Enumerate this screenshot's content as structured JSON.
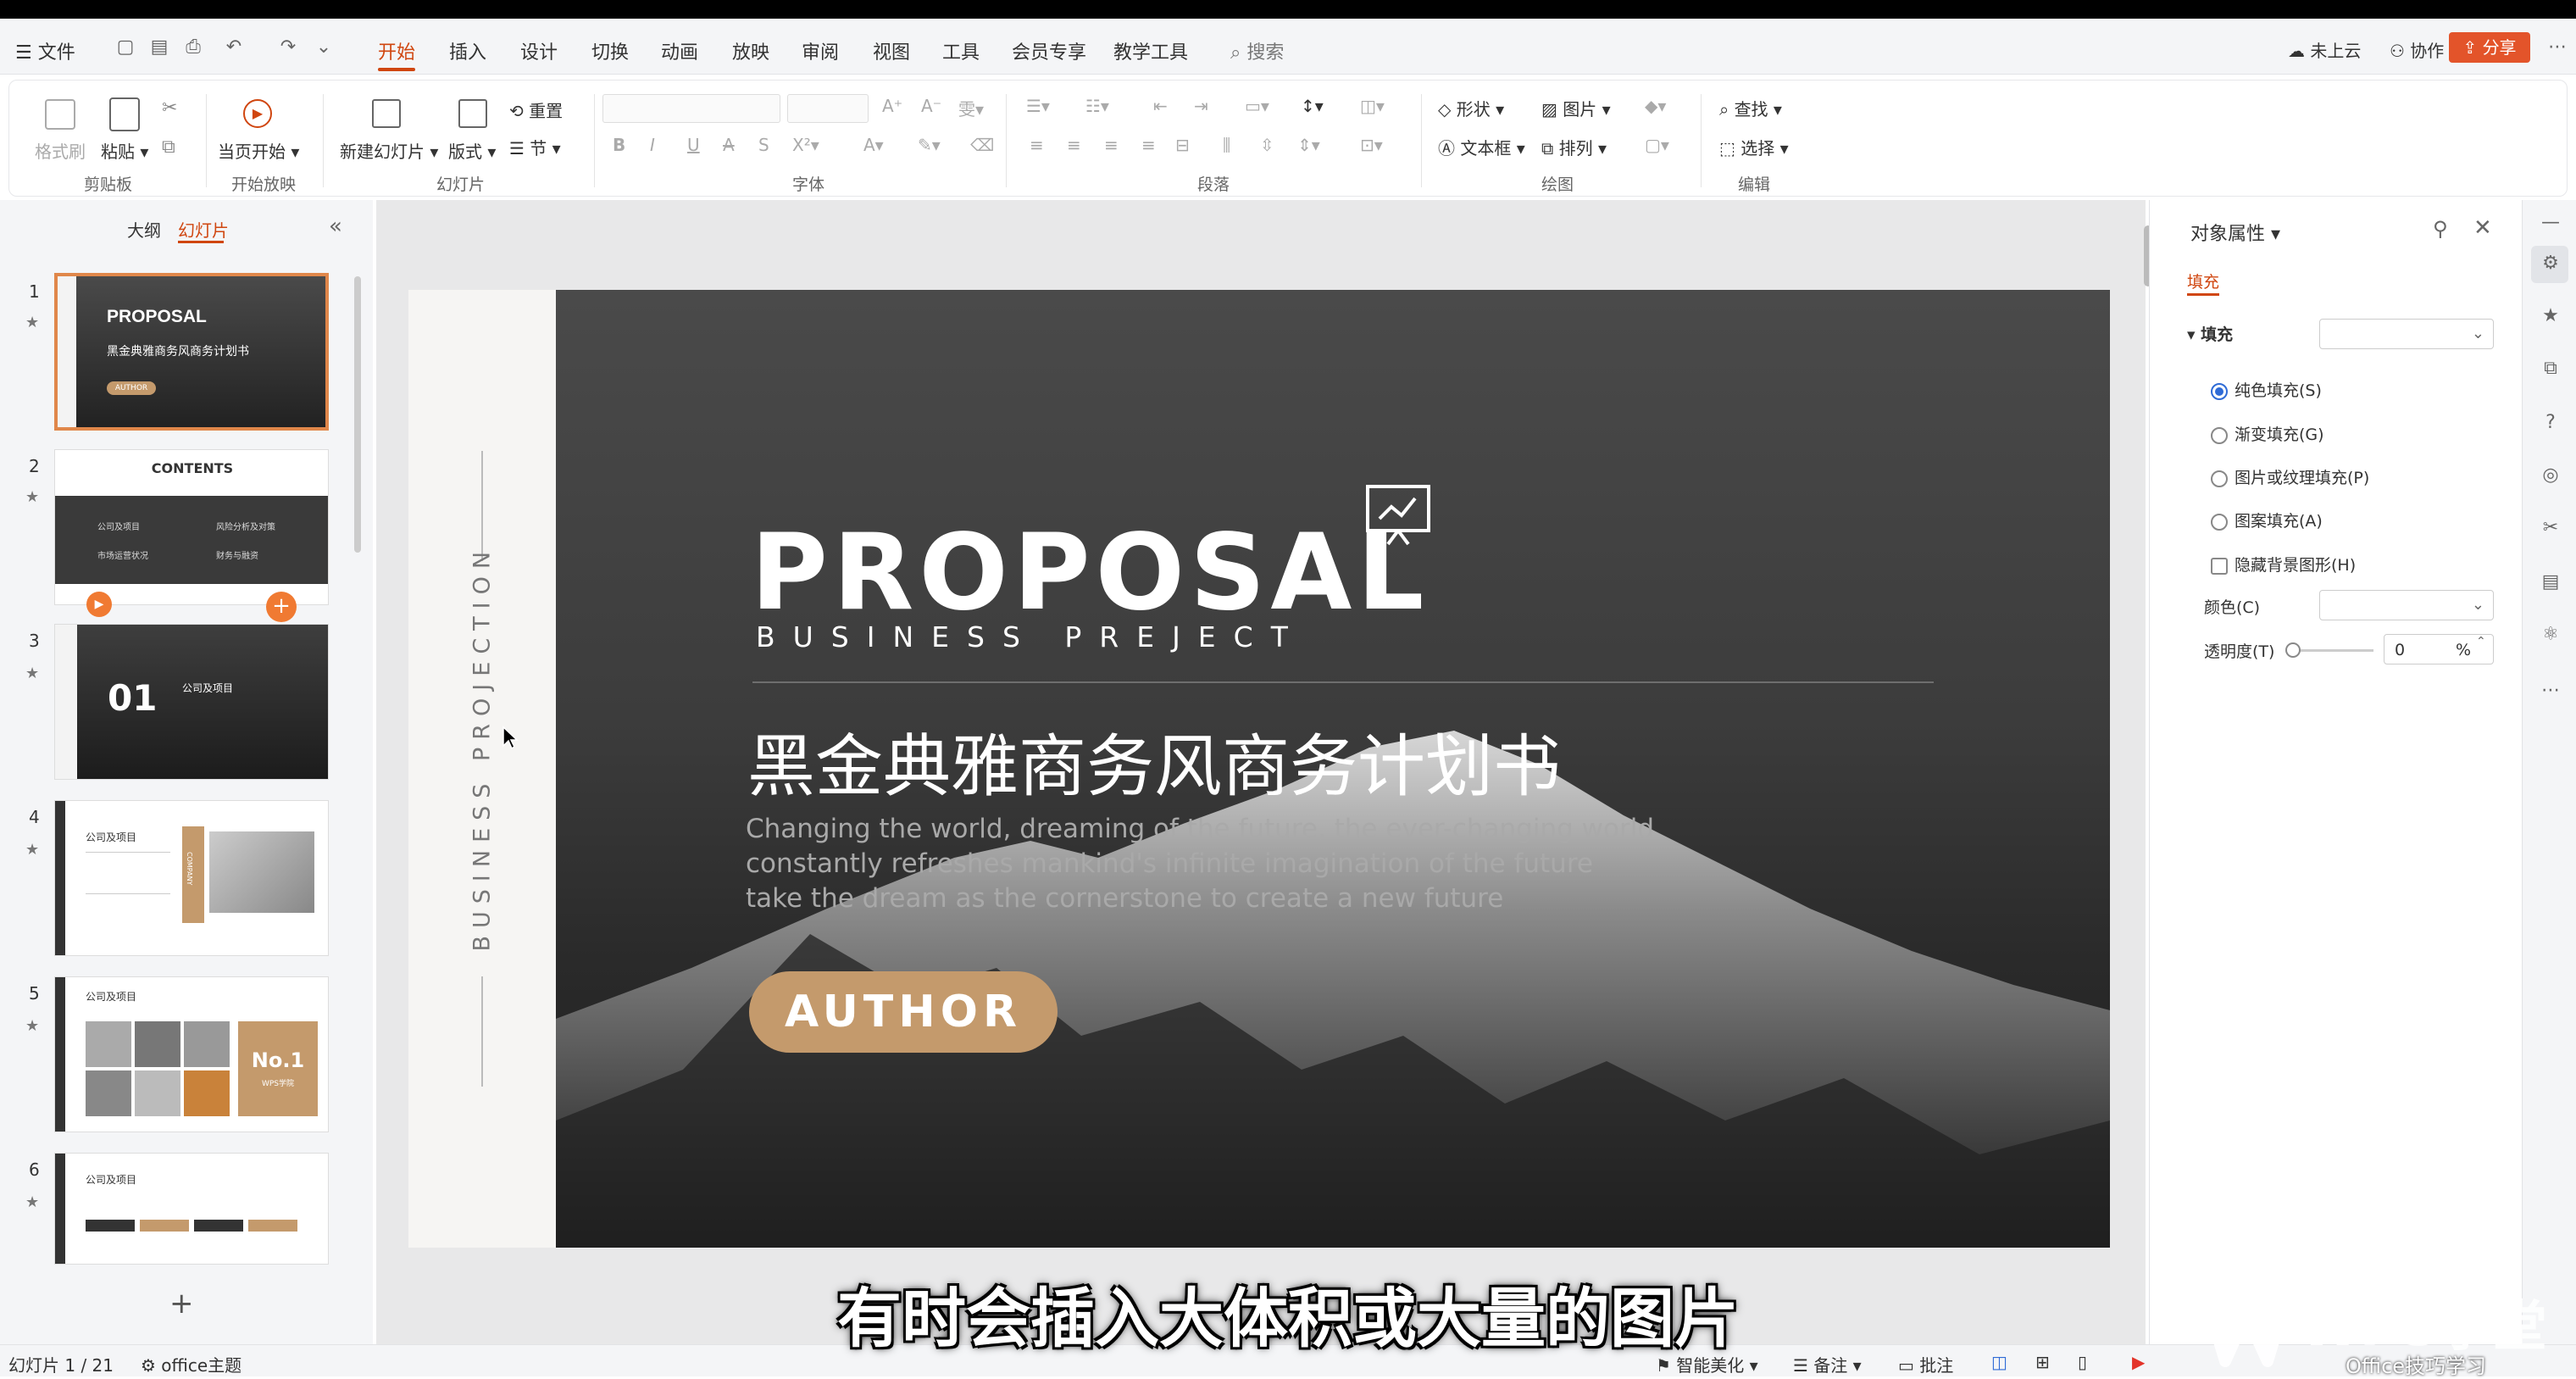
{
  "menubar": {
    "file": "文件",
    "tabs": [
      "开始",
      "插入",
      "设计",
      "切换",
      "动画",
      "放映",
      "审阅",
      "视图",
      "工具",
      "会员专享",
      "教学工具"
    ],
    "active_tab": "开始",
    "search": "搜索",
    "cloud": "未上云",
    "collab": "协作",
    "share": "分享"
  },
  "ribbon": {
    "clipboard": {
      "format_painter": "格式刷",
      "paste": "粘贴",
      "group": "剪贴板"
    },
    "slideshow": {
      "from_current": "当页开始",
      "group": "开始放映"
    },
    "slides": {
      "new_slide": "新建幻灯片",
      "layout": "版式",
      "reset": "重置",
      "section": "节",
      "group": "幻灯片"
    },
    "font": {
      "group": "字体"
    },
    "paragraph": {
      "group": "段落"
    },
    "drawing": {
      "shape": "形状",
      "picture": "图片",
      "textbox": "文本框",
      "arrange": "排列",
      "group": "绘图"
    },
    "edit": {
      "find": "查找",
      "select": "选择",
      "group": "编辑"
    }
  },
  "leftpane": {
    "tab_outline": "大纲",
    "tab_slides": "幻灯片",
    "thumbs": [
      {
        "num": "1",
        "title": "PROPOSAL",
        "sub": "黑金典雅商务风商务计划书",
        "btn": "AUTHOR"
      },
      {
        "num": "2",
        "title": "CONTENTS",
        "items": [
          "公司及项目",
          "风险分析及对策",
          "市场运营状况",
          "财务与融资"
        ]
      },
      {
        "num": "3",
        "title": "01",
        "sub": "公司及项目"
      },
      {
        "num": "4",
        "title": "公司及项目",
        "tag": "COMPANY"
      },
      {
        "num": "5",
        "title": "公司及项目",
        "badge": "No.1",
        "badge_sub": "WPS学院"
      },
      {
        "num": "6",
        "title": "公司及项目"
      }
    ]
  },
  "slide": {
    "vertical_text": "BUSINESS PROJECTION",
    "title": "PROPOSAL",
    "subtitle": "BUSINESS PREJECT",
    "cn_title": "黑金典雅商务风商务计划书",
    "body": [
      "Changing the world, dreaming of the future, the ever-changing world",
      "constantly refreshes mankind's infinite imagination of the future",
      "take the dream as the cornerstone to create a new future"
    ],
    "button": "AUTHOR"
  },
  "rightpane": {
    "title": "对象属性",
    "tab": "填充",
    "section": "填充",
    "options": [
      "纯色填充(S)",
      "渐变填充(G)",
      "图片或纹理填充(P)",
      "图案填充(A)"
    ],
    "hide_bg": "隐藏背景图形(H)",
    "color_label": "颜色(C)",
    "transparency_label": "透明度(T)",
    "transparency_value": "0",
    "transparency_unit": "%"
  },
  "statusbar": {
    "slide_info": "幻灯片 1 / 21",
    "theme": "office主题",
    "beautify": "智能美化",
    "notes": "备注",
    "comments": "批注"
  },
  "overlay": {
    "subtitle": "有时会插入大体积或大量的图片",
    "watermark": "WPS学堂",
    "watermark_sub": "Office技巧学习"
  },
  "colors": {
    "accent": "#d0460f",
    "gold": "#c49a6c",
    "slide_dark": "#3a3a3a"
  }
}
